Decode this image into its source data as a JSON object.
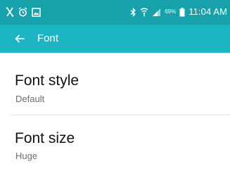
{
  "status_bar": {
    "time": "11:04 AM",
    "battery_text": "69%",
    "icons": [
      "usb-icon",
      "alarm-icon",
      "image-notification-icon",
      "bluetooth-icon",
      "wifi-icon",
      "signal-icon",
      "battery-icon"
    ]
  },
  "action_bar": {
    "title": "Font",
    "back_icon": "arrow-back-icon"
  },
  "settings": [
    {
      "title": "Font style",
      "value": "Default"
    },
    {
      "title": "Font size",
      "value": "Huge"
    }
  ],
  "colors": {
    "status_bar": "#17a2ab",
    "action_bar": "#1cb5c2",
    "primary_text": "#111111",
    "secondary_text": "#6d6d6d"
  }
}
